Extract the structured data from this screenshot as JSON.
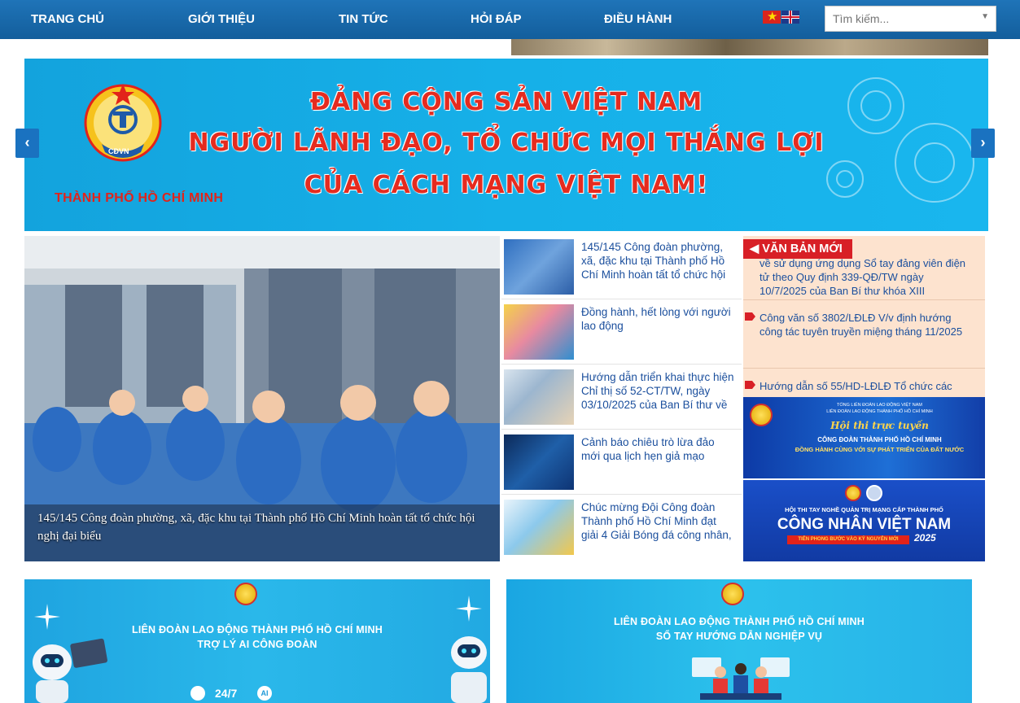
{
  "nav": {
    "items": [
      "TRANG CHỦ",
      "GIỚI THIỆU",
      "TIN TỨC",
      "HỎI ĐÁP",
      "ĐIỀU HÀNH"
    ],
    "search_placeholder": "Tìm kiếm...",
    "lang_flags": [
      "vietnam-flag-icon",
      "uk-flag-icon"
    ]
  },
  "banner": {
    "logo_text": "CĐVN",
    "logo_caption": "THÀNH PHỐ HỒ CHÍ MINH",
    "lines": [
      "ĐẢNG CỘNG SẢN VIỆT NAM",
      "NGƯỜI LÃNH ĐẠO, TỔ CHỨC MỌI THẮNG LỢI",
      "CỦA CÁCH MẠNG VIỆT NAM!"
    ],
    "prev_icon": "‹",
    "next_icon": "›"
  },
  "feature": {
    "caption": "145/145 Công đoàn phường, xã, đặc khu tại Thành phố Hồ Chí Minh hoàn tất tổ chức hội nghị đại biểu"
  },
  "news": [
    {
      "title": "145/145 Công đoàn phường, xã, đặc khu tại Thành phố Hồ Chí Minh hoàn tất tổ chức hội"
    },
    {
      "title": "Đồng hành, hết lòng với người lao động"
    },
    {
      "title": "Hướng dẫn triển khai thực hiện Chỉ thị số 52-CT/TW, ngày 03/10/2025 của Ban Bí thư về"
    },
    {
      "title": "Cảnh báo chiêu trò lừa đảo mới qua lịch hẹn giả mạo"
    },
    {
      "title": "Chúc mừng Đội Công đoàn Thành phố Hồ Chí Minh đạt giải 4 Giải Bóng đá công nhân,"
    }
  ],
  "documents": {
    "heading": "VĂN BẢN MỚI",
    "items": [
      "về sử dụng ứng dụng Sổ tay đảng viên điện tử theo Quy định 339-QĐ/TW ngày 10/7/2025 của Ban Bí thư khóa XIII",
      "Công văn số 3802/LĐLĐ V/v định hướng công tác tuyên truyền miệng tháng 11/2025",
      "Hướng dẫn số 55/HD-LĐLĐ Tổ chức các"
    ]
  },
  "promo1": {
    "org_line1": "TỔNG LIÊN ĐOÀN LAO ĐỘNG VIỆT NAM",
    "org_line2": "LIÊN ĐOÀN LAO ĐỘNG THÀNH PHỐ HỒ CHÍ MINH",
    "contest": "Hội thi trực tuyến",
    "line1": "CÔNG ĐOÀN THÀNH PHỐ HỒ CHÍ MINH",
    "line2": "ĐỒNG HÀNH CÙNG VỚI SỰ PHÁT TRIỂN CỦA ĐẤT NƯỚC"
  },
  "promo2": {
    "line1": "HỘI THI TAY NGHỀ QUẢN TRỊ MẠNG CẤP THÀNH PHỐ",
    "line2": "CÔNG NHÂN VIỆT NAM",
    "line3": "TIÊN PHONG BƯỚC VÀO KỶ NGUYÊN MỚI",
    "year": "2025"
  },
  "card1": {
    "line1": "LIÊN ĐOÀN LAO ĐỘNG THÀNH PHỐ HỒ CHÍ MINH",
    "line2": "TRỢ LÝ AI CÔNG ĐOÀN",
    "hours": "24/7",
    "ai": "AI"
  },
  "card2": {
    "line1": "LIÊN ĐOÀN LAO ĐỘNG THÀNH PHỐ HỒ CHÍ MINH",
    "line2": "SỔ TAY HƯỚNG DẪN NGHIỆP VỤ"
  },
  "colors": {
    "nav": "#1668aa",
    "banner": "#16aee6",
    "accent_red": "#d81f26",
    "link_blue": "#1b4f9d"
  }
}
